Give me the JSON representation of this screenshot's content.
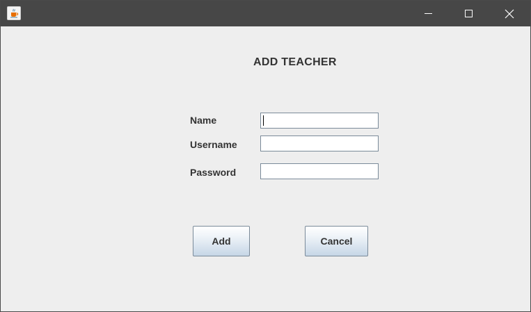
{
  "window": {
    "title": "",
    "app_icon": "java-coffee-cup-icon",
    "controls": {
      "minimize": "minimize-icon",
      "maximize": "maximize-icon",
      "close": "close-icon"
    }
  },
  "form": {
    "heading": "ADD TEACHER",
    "fields": {
      "name": {
        "label": "Name",
        "value": ""
      },
      "username": {
        "label": "Username",
        "value": ""
      },
      "password": {
        "label": "Password",
        "value": ""
      }
    },
    "buttons": {
      "add": "Add",
      "cancel": "Cancel"
    }
  },
  "colors": {
    "titlebar": "#474747",
    "background": "#eeeeee",
    "text": "#333333",
    "field_border": "#7a8a99"
  }
}
